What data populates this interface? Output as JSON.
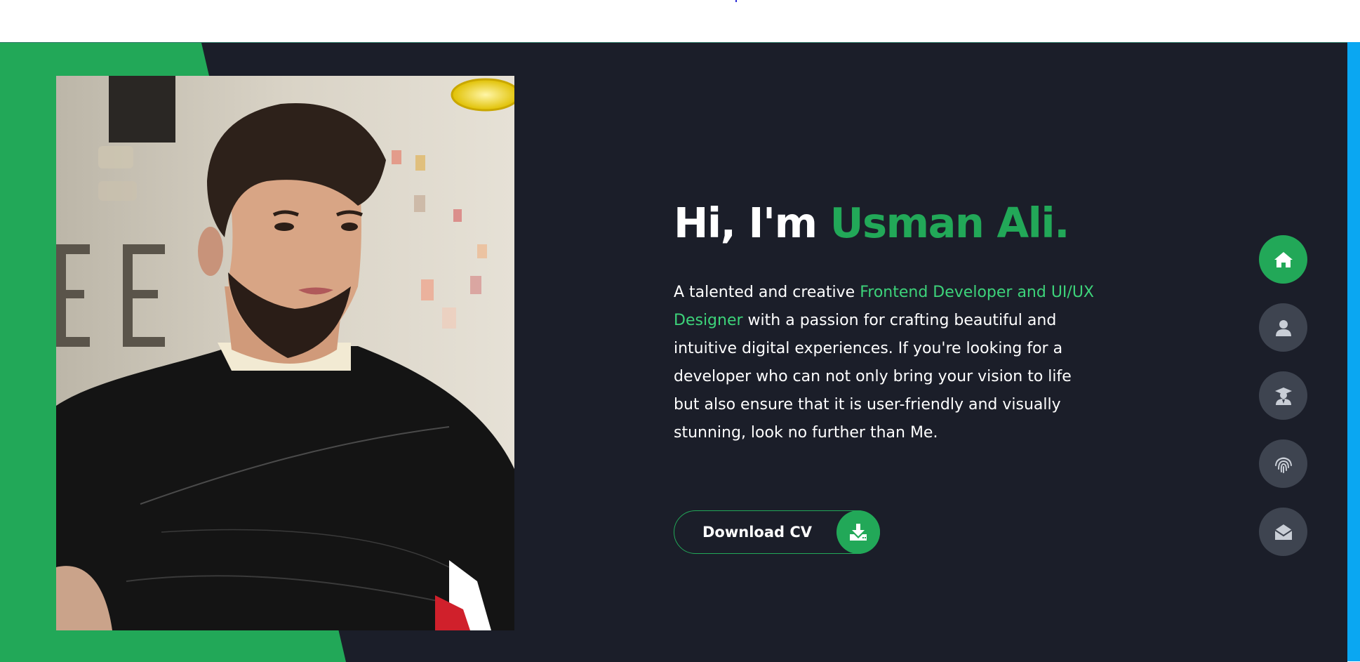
{
  "hero": {
    "greeting": "Hi, I'm",
    "name": "Usman Ali.",
    "intro_before": "A talented and creative",
    "intro_role": "Frontend Developer and UI/UX Designer",
    "intro_after": "with a passion for crafting beautiful and intuitive digital experiences. If you're looking for a developer who can not only bring your vision to life but also ensure that it is user-friendly and visually stunning, look no further than Me.",
    "cv_button_label": "Download CV",
    "cv_button_icon": "download-icon",
    "photo": "profile-photo"
  },
  "nav": {
    "items": [
      {
        "icon": "home-icon",
        "active": true
      },
      {
        "icon": "user-icon",
        "active": false
      },
      {
        "icon": "graduate-icon",
        "active": false
      },
      {
        "icon": "fingerprint-icon",
        "active": false
      },
      {
        "icon": "envelope-open-icon",
        "active": false
      }
    ]
  },
  "colors": {
    "background": "#1b1e29",
    "accent": "#22a858",
    "accent_text": "#3dd37a",
    "nav_inactive": "#3e4450",
    "scrollbar": "#0aa7f2"
  }
}
